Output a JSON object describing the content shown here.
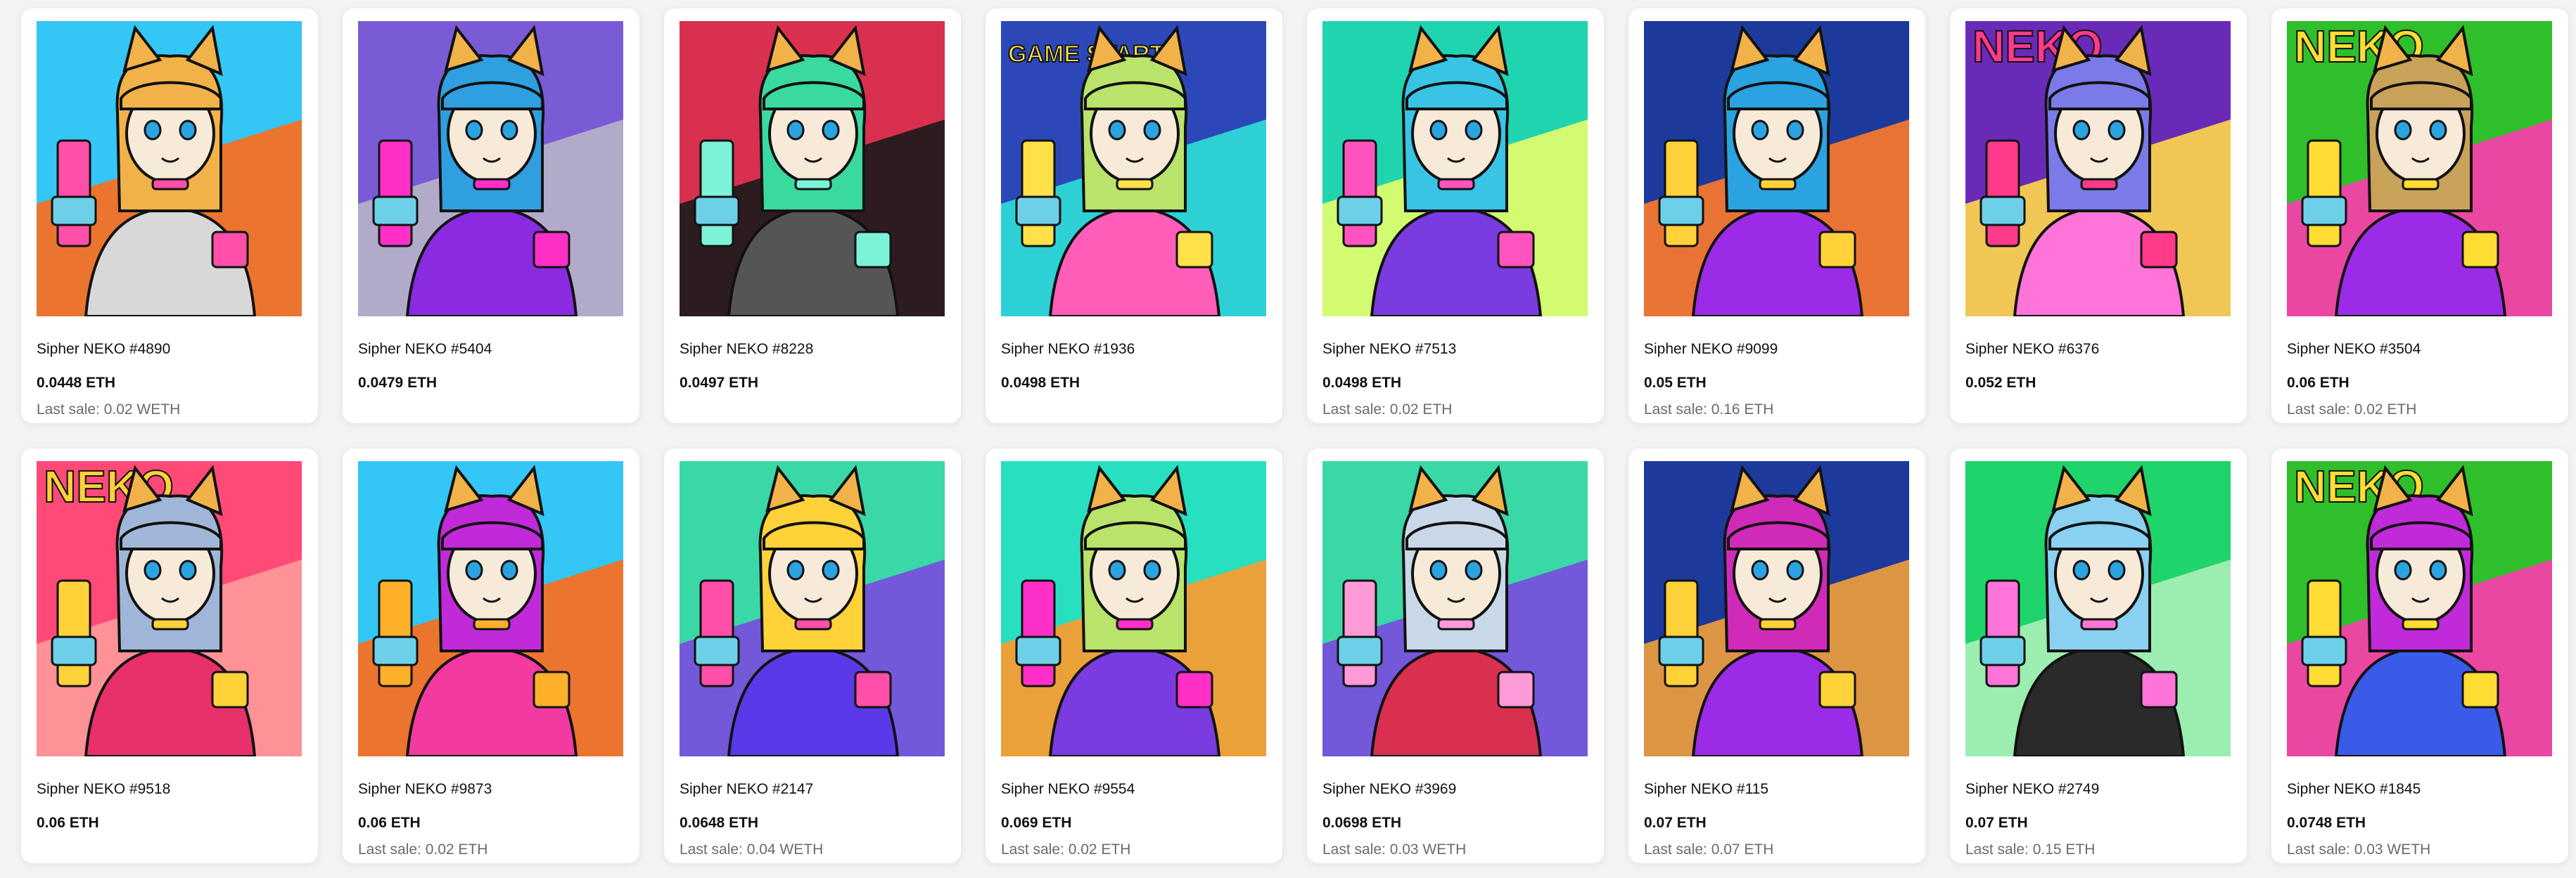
{
  "items": [
    {
      "name": "Sipher NEKO #4890",
      "price": "0.0448 ETH",
      "last_sale": "Last sale: 0.02 WETH",
      "bg": "#34c6f4",
      "bg2": "#ff6a1a",
      "hair": "#f2b24a",
      "outfit": "#d8d8d8",
      "accent": "#ff4fa8"
    },
    {
      "name": "Sipher NEKO #5404",
      "price": "0.0479 ETH",
      "last_sale": "",
      "bg": "#7a5bd6",
      "bg2": "#b7b2c8",
      "hair": "#2f9fe0",
      "outfit": "#8a2be2",
      "accent": "#ff2fc8"
    },
    {
      "name": "Sipher NEKO #8228",
      "price": "0.0497 ETH",
      "last_sale": "",
      "bg": "#d8304e",
      "bg2": "#1b1b1b",
      "hair": "#3ad9a0",
      "outfit": "#555555",
      "accent": "#7cf2d8"
    },
    {
      "name": "Sipher NEKO #1936",
      "price": "0.0498 ETH",
      "last_sale": "",
      "bg": "#2c48b8",
      "bg2": "#2ee0d8",
      "hair": "#b9e36a",
      "outfit": "#ff5db8",
      "accent": "#ffe14a",
      "overlay": "GAME START!"
    },
    {
      "name": "Sipher NEKO #7513",
      "price": "0.0498 ETH",
      "last_sale": "Last sale: 0.02 ETH",
      "bg": "#21d4b0",
      "bg2": "#e6ff6a",
      "hair": "#39c4e6",
      "outfit": "#7a3be0",
      "accent": "#ff54c0"
    },
    {
      "name": "Sipher NEKO #9099",
      "price": "0.05 ETH",
      "last_sale": "Last sale: 0.16 ETH",
      "bg": "#1c3a9c",
      "bg2": "#ff7a2a",
      "hair": "#2aa3e0",
      "outfit": "#9c2be8",
      "accent": "#ffd23a"
    },
    {
      "name": "Sipher NEKO #6376",
      "price": "0.052 ETH",
      "last_sale": "",
      "bg": "#6a2ab8",
      "bg2": "#ffd84a",
      "hair": "#7a7ae8",
      "outfit": "#ff74d8",
      "accent": "#ff3a8a",
      "overlay": "NEKO"
    },
    {
      "name": "Sipher NEKO #3504",
      "price": "0.06 ETH",
      "last_sale": "Last sale: 0.02 ETH",
      "bg": "#2fbf2a",
      "bg2": "#ff3ab0",
      "hair": "#c9a25a",
      "outfit": "#9c2be8",
      "accent": "#ffdd33",
      "overlay": "NEKO"
    },
    {
      "name": "Sipher NEKO #9518",
      "price": "0.06 ETH",
      "last_sale": "",
      "bg": "#ff4a78",
      "bg2": "#ff9a9a",
      "hair": "#9fb6d8",
      "outfit": "#e8306a",
      "accent": "#ffd23a",
      "overlay": "NEKO"
    },
    {
      "name": "Sipher NEKO #9873",
      "price": "0.06 ETH",
      "last_sale": "Last sale: 0.02 ETH",
      "bg": "#34c6f4",
      "bg2": "#ff6a1a",
      "hair": "#c02ad8",
      "outfit": "#f23aa0",
      "accent": "#ffb02a"
    },
    {
      "name": "Sipher NEKO #2147",
      "price": "0.0648 ETH",
      "last_sale": "Last sale: 0.04 WETH",
      "bg": "#3ad8a6",
      "bg2": "#7a4ae0",
      "hair": "#ffd23a",
      "outfit": "#5a3ae8",
      "accent": "#ff4fa8"
    },
    {
      "name": "Sipher NEKO #9554",
      "price": "0.069 ETH",
      "last_sale": "Last sale: 0.02 ETH",
      "bg": "#28e0c0",
      "bg2": "#ff9a2a",
      "hair": "#b9e36a",
      "outfit": "#7a3be0",
      "accent": "#ff2fc8"
    },
    {
      "name": "Sipher NEKO #3969",
      "price": "0.0698 ETH",
      "last_sale": "Last sale: 0.03 WETH",
      "bg": "#3ad8a6",
      "bg2": "#7a4ae0",
      "hair": "#c8d8e8",
      "outfit": "#d8304e",
      "accent": "#ff9ad8"
    },
    {
      "name": "Sipher NEKO #115",
      "price": "0.07 ETH",
      "last_sale": "Last sale: 0.07 ETH",
      "bg": "#1c3a9c",
      "bg2": "#f2a03a",
      "hair": "#d02ab8",
      "outfit": "#9c2be8",
      "accent": "#ffd23a"
    },
    {
      "name": "Sipher NEKO #2749",
      "price": "0.07 ETH",
      "last_sale": "Last sale: 0.15 ETH",
      "bg": "#1fd46a",
      "bg2": "#a8f0b8",
      "hair": "#8ad0f0",
      "outfit": "#2a2a2a",
      "accent": "#ff74d8"
    },
    {
      "name": "Sipher NEKO #1845",
      "price": "0.0748 ETH",
      "last_sale": "Last sale: 0.03 WETH",
      "bg": "#2fbf2a",
      "bg2": "#ff3ab0",
      "hair": "#c02ad8",
      "outfit": "#3a5ae8",
      "accent": "#ffdd33",
      "overlay": "NEKO"
    }
  ]
}
